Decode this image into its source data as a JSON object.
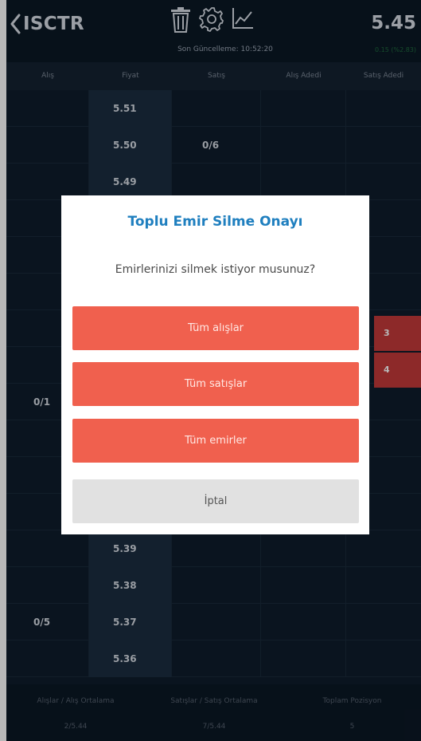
{
  "header": {
    "symbol": "ISCTR",
    "last_update": "Son Güncelleme: 10:52:20",
    "price": "5.45",
    "change": "0.15 (%2.83)",
    "icons": [
      "trash-icon",
      "gear-icon",
      "chart-icon",
      "chevron-left-icon"
    ]
  },
  "columns": [
    "Alış",
    "Fiyat",
    "Satış",
    "Alış Adedi",
    "Satış Adedi"
  ],
  "rows": [
    {
      "alis": "",
      "fiyat": "5.51",
      "satis": ""
    },
    {
      "alis": "",
      "fiyat": "5.50",
      "satis": "0/6"
    },
    {
      "alis": "",
      "fiyat": "5.49",
      "satis": ""
    },
    {
      "alis": "",
      "fiyat": "",
      "satis": ""
    },
    {
      "alis": "",
      "fiyat": "",
      "satis": ""
    },
    {
      "alis": "",
      "fiyat": "",
      "satis": ""
    },
    {
      "alis": "",
      "fiyat": "",
      "satis": ""
    },
    {
      "alis": "",
      "fiyat": "",
      "satis": ""
    },
    {
      "alis": "0/1",
      "fiyat": "",
      "satis": ""
    },
    {
      "alis": "",
      "fiyat": "",
      "satis": ""
    },
    {
      "alis": "",
      "fiyat": "",
      "satis": ""
    },
    {
      "alis": "",
      "fiyat": "",
      "satis": ""
    },
    {
      "alis": "",
      "fiyat": "5.39",
      "satis": ""
    },
    {
      "alis": "",
      "fiyat": "5.38",
      "satis": ""
    },
    {
      "alis": "0/5",
      "fiyat": "5.37",
      "satis": ""
    },
    {
      "alis": "",
      "fiyat": "5.36",
      "satis": ""
    }
  ],
  "sell_qty_cells": [
    "3",
    "4"
  ],
  "footer": {
    "labels": [
      "Alışlar / Alış Ortalama",
      "Satışlar / Satış Ortalama",
      "Toplam Pozisyon"
    ],
    "values": [
      "2/5.44",
      "7/5.44",
      "5"
    ]
  },
  "dialog": {
    "title": "Toplu Emir Silme Onayı",
    "message": "Emirlerinizi silmek istiyor musunuz?",
    "buttons": [
      "Tüm alışlar",
      "Tüm satışlar",
      "Tüm emirler",
      "İptal"
    ]
  },
  "colors": {
    "accent": "#1f7fbf",
    "danger_button": "#f0604e",
    "sell_highlight": "#c43a3a",
    "background": "#0e1c2b"
  }
}
